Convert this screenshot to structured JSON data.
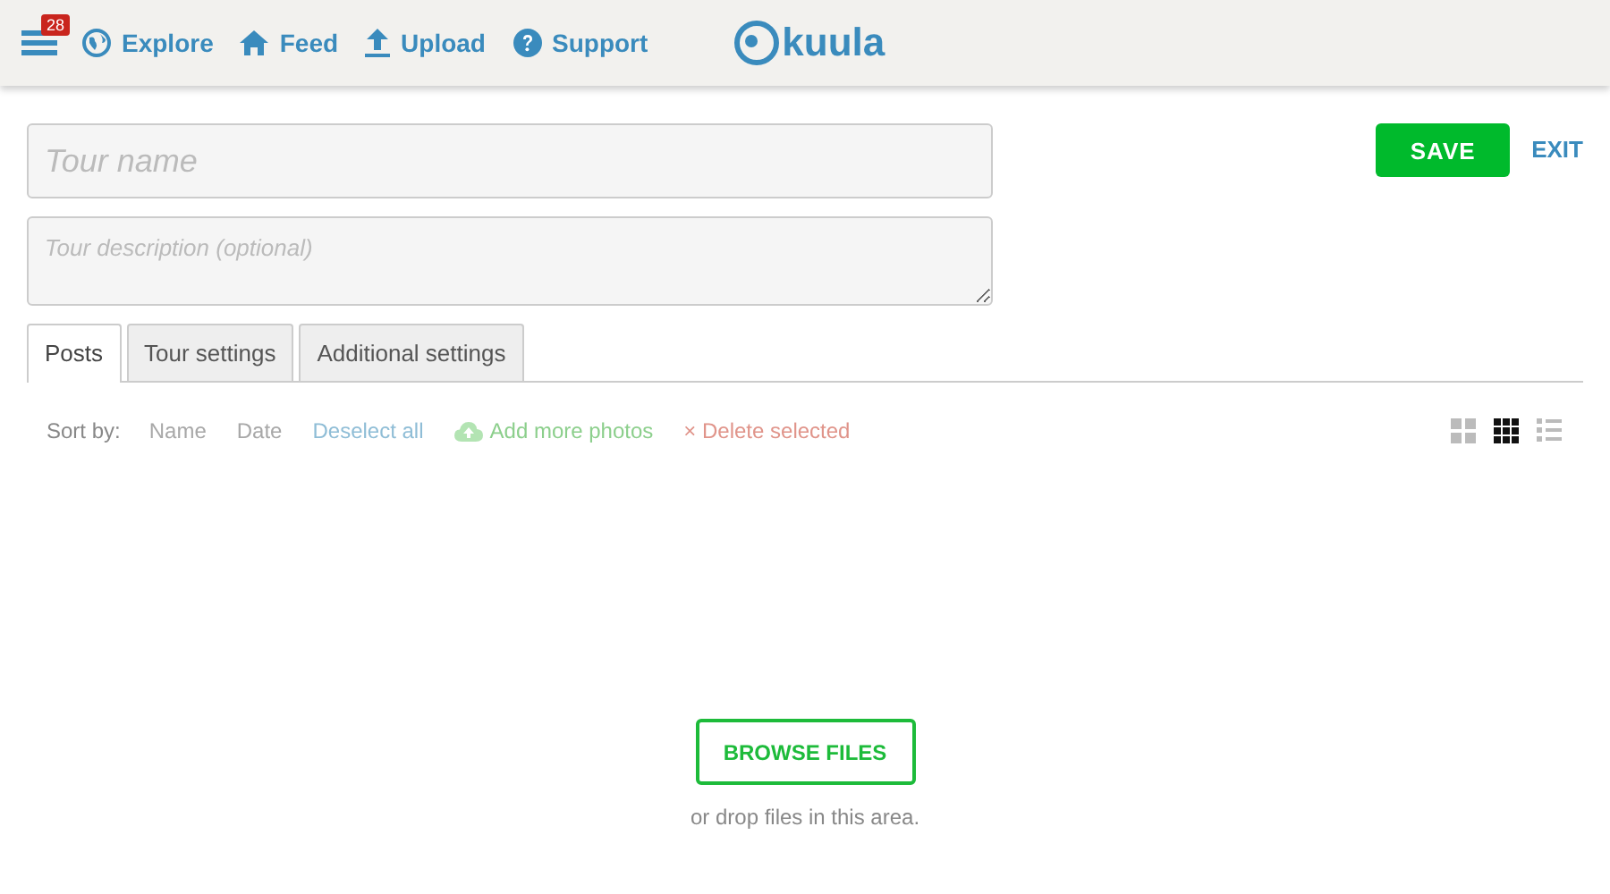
{
  "header": {
    "menu_badge": "28",
    "nav": [
      {
        "label": "Explore"
      },
      {
        "label": "Feed"
      },
      {
        "label": "Upload"
      },
      {
        "label": "Support"
      }
    ],
    "logo": "kuula"
  },
  "form": {
    "name_placeholder": "Tour name",
    "description_placeholder": "Tour description (optional)"
  },
  "actions": {
    "save": "SAVE",
    "exit": "EXIT"
  },
  "tabs": [
    {
      "label": "Posts",
      "selected": true
    },
    {
      "label": "Tour settings",
      "selected": false
    },
    {
      "label": "Additional settings",
      "selected": false
    }
  ],
  "toolbar": {
    "sort_label": "Sort by:",
    "sort_options": [
      "Name",
      "Date"
    ],
    "deselect": "Deselect all",
    "add": "Add more photos",
    "delete": "× Delete selected"
  },
  "views": [
    {
      "selected": false
    },
    {
      "selected": true
    },
    {
      "selected": false
    }
  ],
  "upload": {
    "button": "BROWSE FILES",
    "hint": "or drop files in this area."
  }
}
